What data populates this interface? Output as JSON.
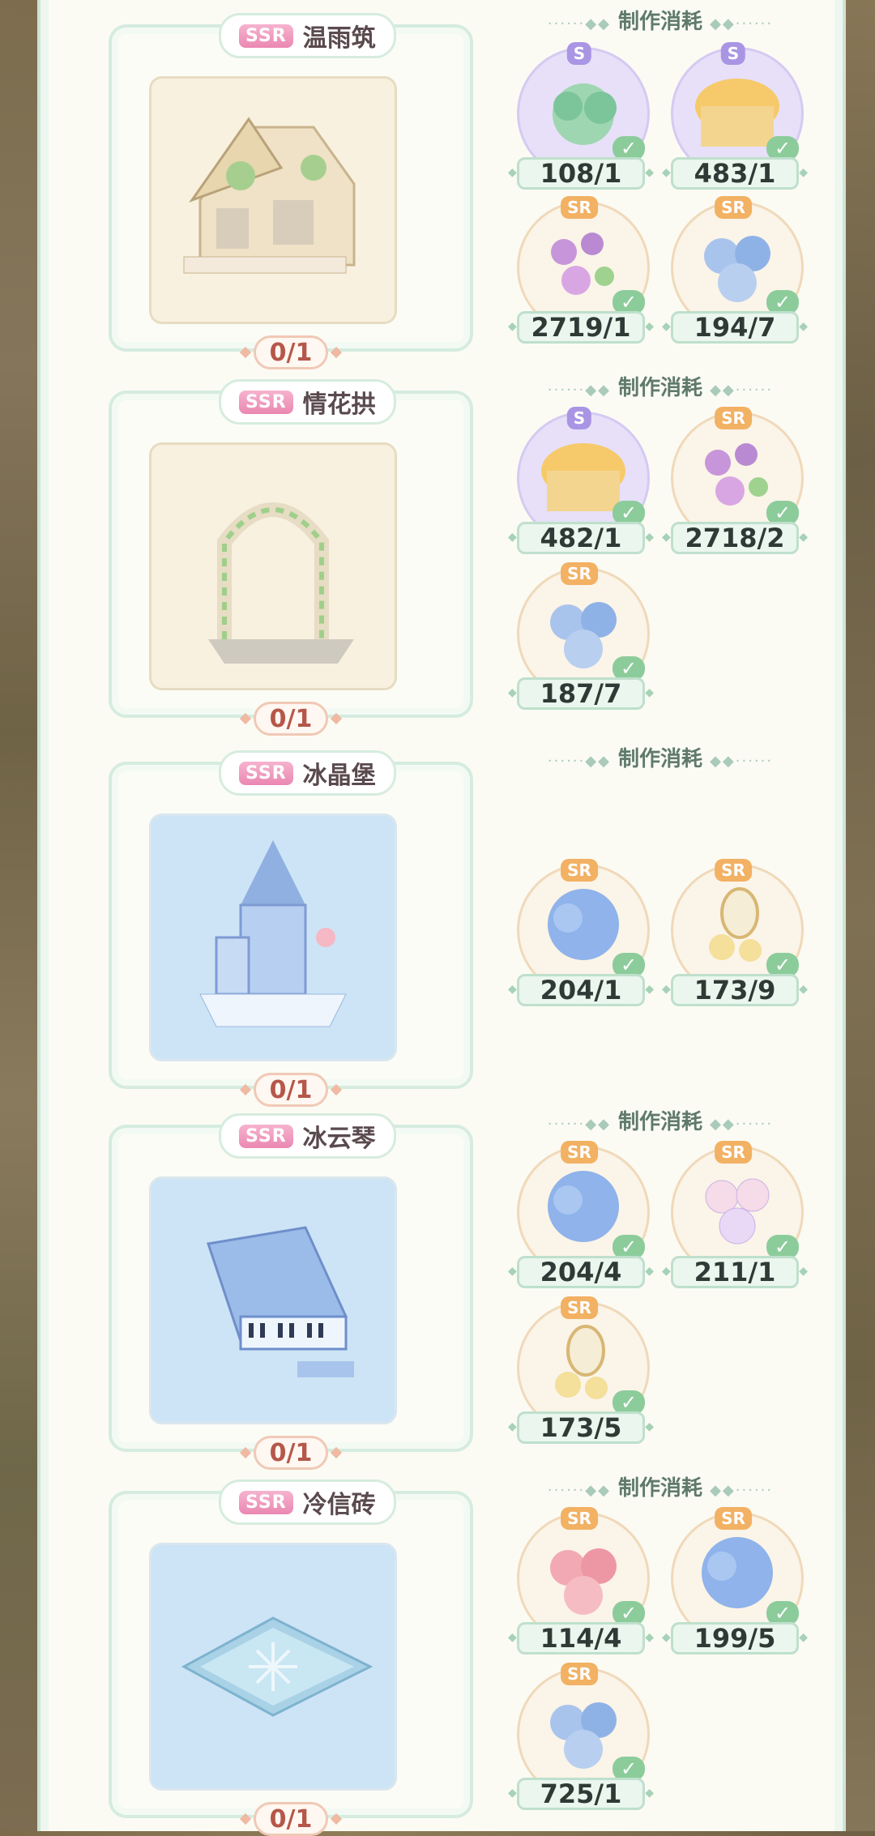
{
  "section_label": "制作消耗",
  "rarity_badge": "SSR",
  "items": [
    {
      "name": "温雨筑",
      "owned": "0/1",
      "materials": [
        {
          "grade": "S",
          "icon": "green-leaf-plant-icon",
          "qty": "108/1"
        },
        {
          "grade": "S",
          "icon": "yellow-jellyfish-lamp-icon",
          "qty": "483/1"
        },
        {
          "grade": "SR",
          "icon": "purple-flower-arch-icon",
          "qty": "2719/1"
        },
        {
          "grade": "SR",
          "icon": "blue-flower-bouquet-icon",
          "qty": "194/7"
        }
      ]
    },
    {
      "name": "情花拱",
      "owned": "0/1",
      "materials": [
        {
          "grade": "S",
          "icon": "yellow-jellyfish-lamp-icon",
          "qty": "482/1"
        },
        {
          "grade": "SR",
          "icon": "purple-flower-arch-icon",
          "qty": "2718/2"
        },
        {
          "grade": "SR",
          "icon": "blue-flower-bouquet-icon",
          "qty": "187/7"
        }
      ]
    },
    {
      "name": "冰晶堡",
      "owned": "0/1",
      "materials": [
        {
          "grade": "SR",
          "icon": "blue-hydrangea-icon",
          "qty": "204/1"
        },
        {
          "grade": "SR",
          "icon": "yellow-flower-mirror-icon",
          "qty": "173/9"
        }
      ]
    },
    {
      "name": "冰云琴",
      "owned": "0/1",
      "materials": [
        {
          "grade": "SR",
          "icon": "blue-hydrangea-icon",
          "qty": "204/4"
        },
        {
          "grade": "SR",
          "icon": "bubble-flower-icon",
          "qty": "211/1"
        },
        {
          "grade": "SR",
          "icon": "yellow-flower-mirror-icon",
          "qty": "173/5"
        }
      ]
    },
    {
      "name": "冷信砖",
      "owned": "0/1",
      "materials": [
        {
          "grade": "SR",
          "icon": "pink-flower-cluster-icon",
          "qty": "114/4"
        },
        {
          "grade": "SR",
          "icon": "blue-hydrangea-icon",
          "qty": "199/5"
        },
        {
          "grade": "SR",
          "icon": "blue-flower-bouquet-icon",
          "qty": "725/1"
        }
      ]
    }
  ]
}
